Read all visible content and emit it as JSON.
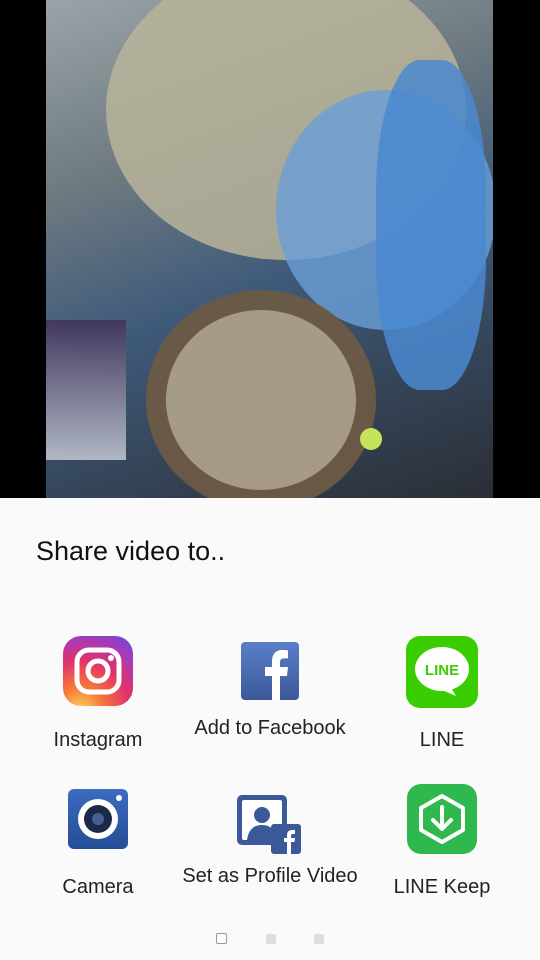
{
  "share_sheet": {
    "title": "Share video to..",
    "items": [
      {
        "label": "Instagram",
        "icon": "instagram-icon"
      },
      {
        "label": "Add to Facebook",
        "icon": "facebook-icon"
      },
      {
        "label": "LINE",
        "icon": "line-icon"
      },
      {
        "label": "Camera",
        "icon": "camera-icon"
      },
      {
        "label": "Set as Profile Video",
        "icon": "profile-video-icon"
      },
      {
        "label": "LINE Keep",
        "icon": "line-keep-icon"
      }
    ],
    "page_indicator": {
      "pages": 3,
      "current": 1
    }
  },
  "colors": {
    "sheet_bg": "#fafafa",
    "facebook_blue": "#3b5998",
    "line_green": "#3acd01",
    "line_keep_green": "#2fb84e",
    "camera_blue": "#2e5aa8"
  }
}
